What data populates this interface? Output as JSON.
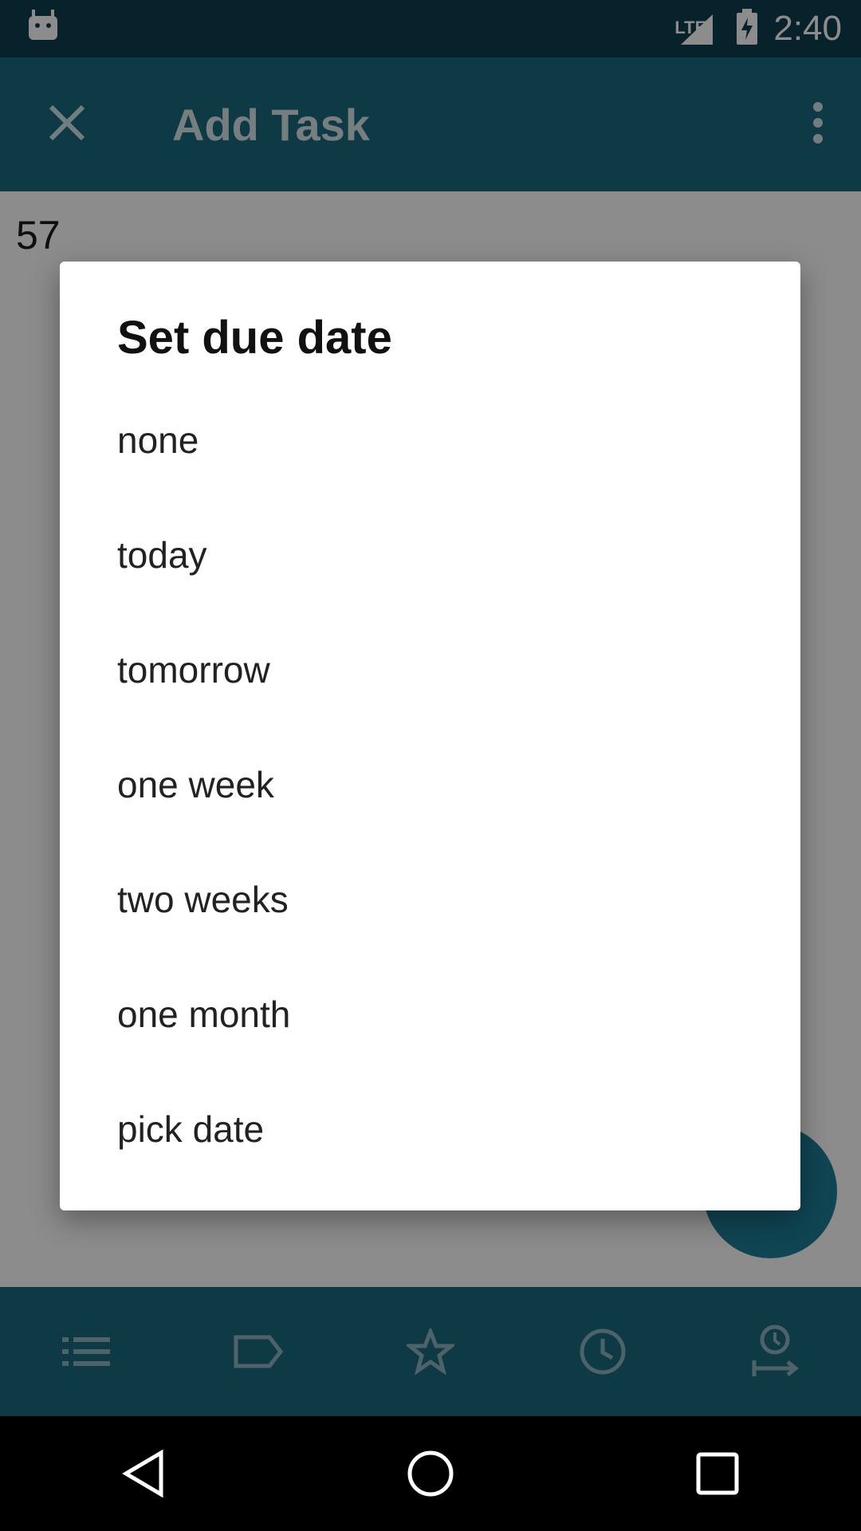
{
  "status_bar": {
    "time": "2:40",
    "network": "LTE"
  },
  "app_bar": {
    "title": "Add Task"
  },
  "content": {
    "task_number": "57"
  },
  "dialog": {
    "title": "Set due date",
    "options": [
      "none",
      "today",
      "tomorrow",
      "one week",
      "two weeks",
      "one month",
      "pick date"
    ]
  },
  "bottom_bar": {
    "icons": [
      "list-icon",
      "tag-icon",
      "star-icon",
      "clock-icon",
      "reminder-icon"
    ]
  },
  "colors": {
    "primary": "#1b6a80",
    "status": "#0f3f4f",
    "accent": "#1e7f9a"
  }
}
